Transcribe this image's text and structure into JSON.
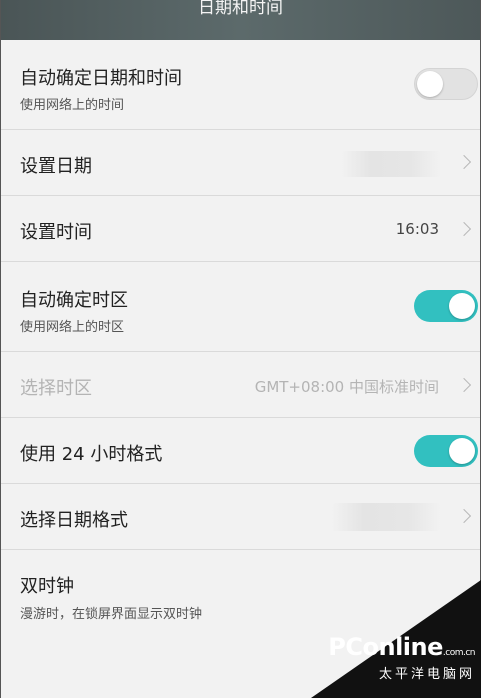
{
  "header": {
    "title": "日期和时间"
  },
  "rows": [
    {
      "label": "自动确定日期和时间",
      "sub": "使用网络上的时间",
      "toggle": "off"
    },
    {
      "label": "设置日期"
    },
    {
      "label": "设置时间",
      "value": "16:03"
    },
    {
      "label": "自动确定时区",
      "sub": "使用网络上的时区",
      "toggle": "on"
    },
    {
      "label": "选择时区",
      "value": "GMT+08:00 中国标准时间",
      "disabled": true
    },
    {
      "label": "使用 24 小时格式",
      "toggle": "on"
    },
    {
      "label": "选择日期格式"
    },
    {
      "label": "双时钟",
      "sub": "漫游时，在锁屏界面显示双时钟"
    }
  ],
  "watermark": {
    "logo": "PConline",
    "domain": ".com.cn",
    "subtitle": "太平洋电脑网"
  },
  "colors": {
    "accent": "#32c0c0",
    "header_bg": "#56625f",
    "background": "#f2f2f2"
  }
}
